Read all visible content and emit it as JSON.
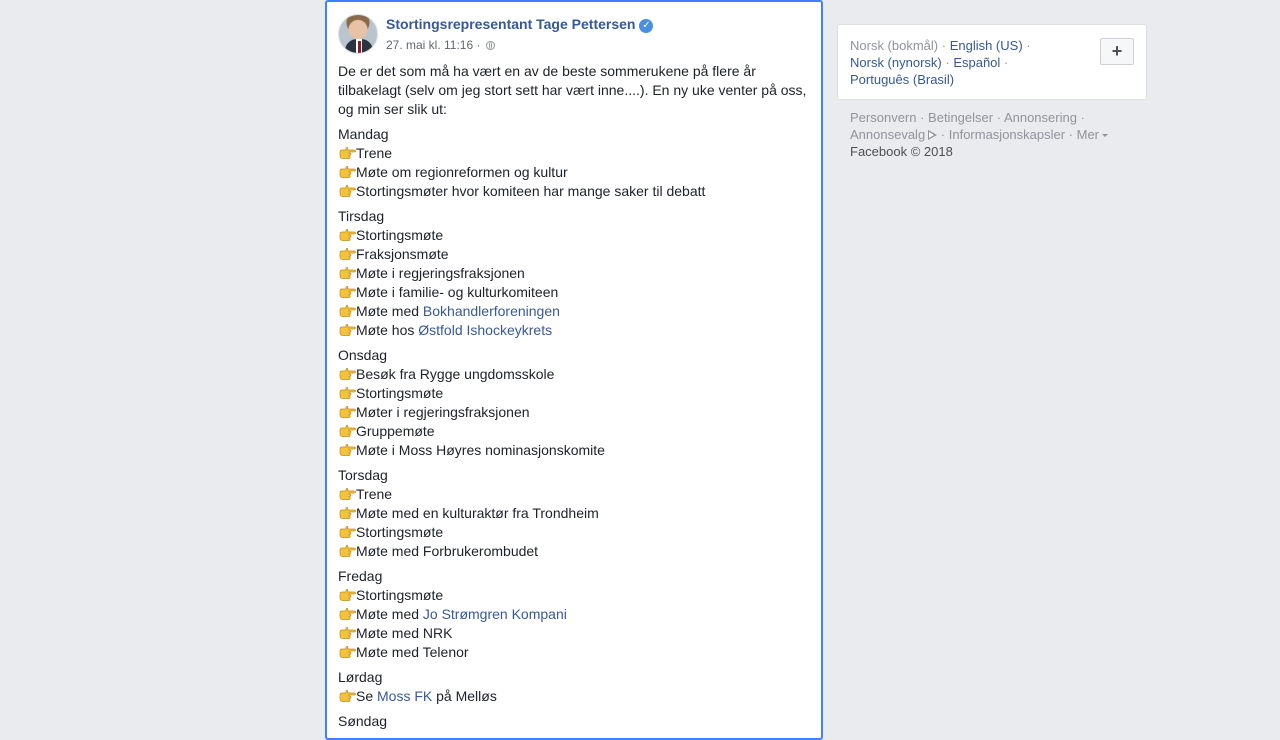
{
  "post": {
    "author": "Stortingsrepresentant Tage Pettersen",
    "timestamp": "27. mai kl. 11:16",
    "meta_sep": " · ",
    "intro": "De er det som må ha vært en av de beste sommerukene på flere år tilbakelagt (selv om jeg stort sett har vært inne....). En ny uke venter på oss, og min ser slik ut:",
    "days": [
      {
        "name": "Mandag",
        "items": [
          {
            "text": "Trene"
          },
          {
            "text": "Møte om regionreformen og kultur"
          },
          {
            "text": "Stortingsmøter hvor komiteen har mange saker til debatt"
          }
        ]
      },
      {
        "name": "Tirsdag",
        "items": [
          {
            "text": "Stortingsmøte"
          },
          {
            "text": "Fraksjonsmøte"
          },
          {
            "text": "Møte i regjeringsfraksjonen"
          },
          {
            "text": "Møte i familie- og kulturkomiteen"
          },
          {
            "text": "Møte med ",
            "link": "Bokhandlerforeningen",
            "after": ""
          },
          {
            "text": "Møte hos ",
            "link": "Østfold Ishockeykrets",
            "after": ""
          }
        ]
      },
      {
        "name": "Onsdag",
        "items": [
          {
            "text": "Besøk fra Rygge ungdomsskole"
          },
          {
            "text": "Stortingsmøte"
          },
          {
            "text": "Møter i regjeringsfraksjonen"
          },
          {
            "text": "Gruppemøte"
          },
          {
            "text": "Møte i Moss Høyres nominasjonskomite"
          }
        ]
      },
      {
        "name": "Torsdag",
        "items": [
          {
            "text": "Trene"
          },
          {
            "text": "Møte med en kulturaktør fra Trondheim"
          },
          {
            "text": "Stortingsmøte"
          },
          {
            "text": "Møte med Forbrukerombudet"
          }
        ]
      },
      {
        "name": "Fredag",
        "items": [
          {
            "text": "Stortingsmøte"
          },
          {
            "text": "Møte med ",
            "link": "Jo Strømgren Kompani",
            "after": ""
          },
          {
            "text": "Møte med NRK"
          },
          {
            "text": "Møte med Telenor"
          }
        ]
      },
      {
        "name": "Lørdag",
        "items": [
          {
            "text": "Se ",
            "link": "Moss FK",
            "after": " på Melløs"
          }
        ]
      },
      {
        "name": "Søndag",
        "items": []
      }
    ]
  },
  "languages": {
    "current": "Norsk (bokmål)",
    "others": [
      "English (US)",
      "Norsk (nynorsk)",
      "Español",
      "Português (Brasil)"
    ],
    "add_label": "+"
  },
  "footer": {
    "links": [
      "Personvern",
      "Betingelser",
      "Annonsering",
      "Annonsevalg",
      "Informasjonskapsler",
      "Mer"
    ],
    "copyright": "Facebook © 2018"
  },
  "colors": {
    "link": "#385898",
    "selection_border": "#4080ff",
    "background": "#e9ebee"
  },
  "icons": {
    "pointing": "backhand-index-pointing-right-icon",
    "verified": "verified-badge-icon",
    "audience": "globe-icon",
    "ad_choices": "ad-choices-icon"
  }
}
